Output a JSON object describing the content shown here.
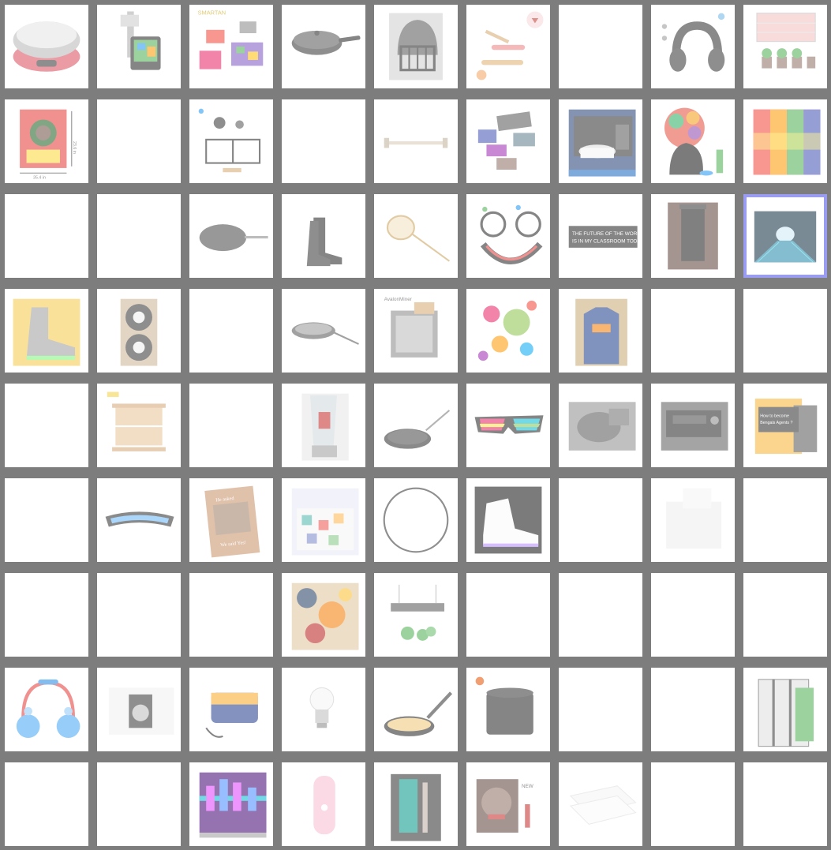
{
  "grid": {
    "rows": 9,
    "cols": 9,
    "selected": {
      "row": 2,
      "col": 8
    },
    "cells": [
      [
        "kitchen-scale",
        "weather-station",
        "kids-craft-kit",
        "frying-pan",
        "lacrosse-helmet",
        "pastry-tools",
        "",
        "neck-headphones",
        "grow-light-panel"
      ],
      [
        "bob-marley-tapestry",
        "",
        "sewing-machine-parts",
        "",
        "towel-bar",
        "color-samples",
        "bathroom-poster",
        "afro-woman-poster",
        "rainbow-cube-tapestry"
      ],
      [
        "",
        "",
        "crepe-pan",
        "black-boots",
        "tea-strainer",
        "neck-fan",
        "classroom-sign",
        "trash-can",
        "tunnel-backdrop"
      ],
      [
        "light-up-sneaker",
        "trailer-tires",
        "",
        "round-pan",
        "crypto-miner",
        "cartoon-collage",
        "blue-hoodie",
        "",
        ""
      ],
      [
        "",
        "wooden-beehive",
        "",
        "blender",
        "crepe-pan-2",
        "rainbow-sunglasses",
        "gearbox-part",
        "car-radio",
        "yellow-machine"
      ],
      [
        "",
        "wrap-sunglasses",
        "photo-frame",
        "robot-bedding",
        "round-mirror",
        "led-sneaker",
        "",
        "white-pillow",
        ""
      ],
      [
        "",
        "",
        "",
        "abstract-shower-curtain",
        "led-grow-light",
        "",
        "",
        "",
        ""
      ],
      [
        "kids-headphones",
        "coin-holder",
        "sewing-case",
        "led-bulb",
        "pizza-pan",
        "grow-bag",
        "",
        "",
        "air-filter-box"
      ],
      [
        "",
        "",
        "neon-city-tapestry",
        "face-mister",
        "garden-tool-box",
        "lipstick-ad",
        "white-sheets",
        "",
        ""
      ]
    ],
    "labels": {
      "weather_station_brand": "SMARTAN",
      "classroom_sign_line1": "THE FUTURE OF THE WORLD",
      "classroom_sign_line2": "IS IN MY CLASSROOM TODAY",
      "crypto_miner_title": "AvalonMiner",
      "yellow_machine_text": "How to become Bengals Agents ?",
      "photo_frame_top": "He asked",
      "photo_frame_bottom": "We said Yes!",
      "lipstick_ad_title": "NEW",
      "bathroom_poster_caption": "bathroom",
      "measure_height": "23.6 in",
      "measure_width": "35.4 in"
    }
  },
  "colors": {
    "gutter": "#7d7d7d",
    "cell_bg": "#ffffff",
    "selected_border": "#9a9cf2"
  }
}
